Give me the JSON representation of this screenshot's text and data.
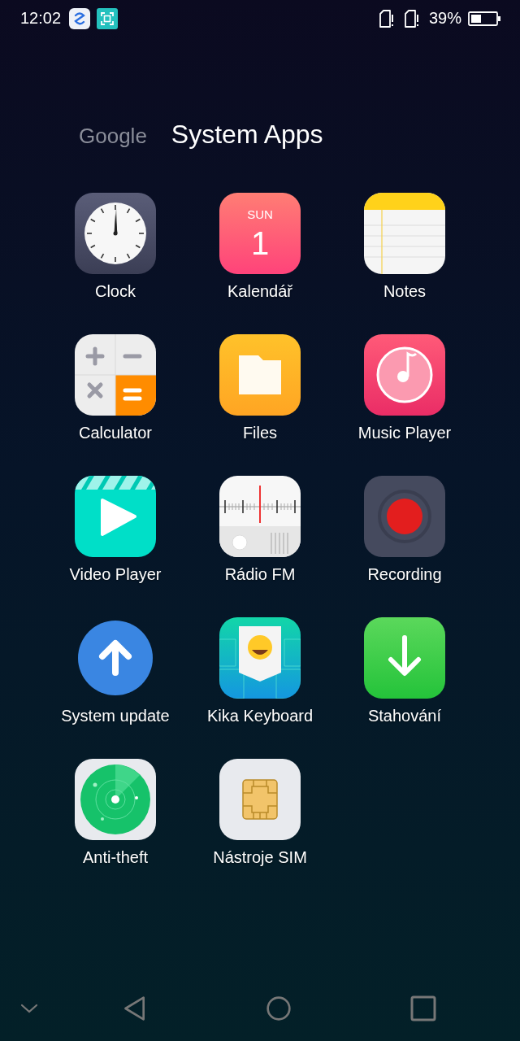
{
  "status_bar": {
    "time": "12:02",
    "battery": "39%"
  },
  "tabs": [
    {
      "label": "Google",
      "selected": false
    },
    {
      "label": "System Apps",
      "selected": true
    }
  ],
  "apps": [
    {
      "label": "Clock",
      "kind": "clock"
    },
    {
      "label": "Kalendář",
      "kind": "calendar"
    },
    {
      "label": "Notes",
      "kind": "notes"
    },
    {
      "label": "Calculator",
      "kind": "calculator"
    },
    {
      "label": "Files",
      "kind": "files"
    },
    {
      "label": "Music Player",
      "kind": "music"
    },
    {
      "label": "Video Player",
      "kind": "video"
    },
    {
      "label": "Rádio FM",
      "kind": "radio"
    },
    {
      "label": "Recording",
      "kind": "recording"
    },
    {
      "label": "System update",
      "kind": "update"
    },
    {
      "label": "Kika Keyboard",
      "kind": "keyboard"
    },
    {
      "label": "Stahování",
      "kind": "download"
    },
    {
      "label": "Anti-theft",
      "kind": "radar"
    },
    {
      "label": "Nástroje SIM",
      "kind": "sim"
    }
  ],
  "calendar_icon": {
    "day": "SUN",
    "date": "1"
  }
}
